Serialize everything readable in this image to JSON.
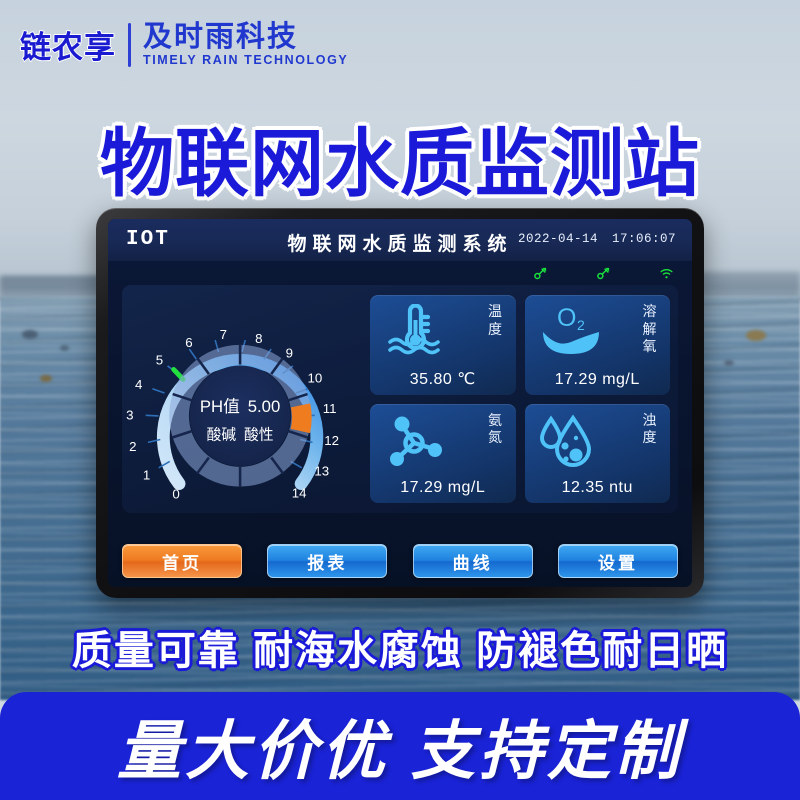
{
  "brand": {
    "mark": "链农享",
    "name_cn": "及时雨科技",
    "name_en": "TIMELY RAIN TECHNOLOGY"
  },
  "headline": "物联网水质监测站",
  "feature_line": "质量可靠 耐海水腐蚀 防褪色耐日晒",
  "banner": "量大价优 支持定制",
  "device": {
    "header": {
      "logo": "IOT",
      "title": "物联网水质监测系统",
      "date": "2022-04-14",
      "time": "17:06:07"
    },
    "status_icons": [
      {
        "name": "plug-icon",
        "color": "#19e03c"
      },
      {
        "name": "plug-icon",
        "color": "#19e03c"
      },
      {
        "name": "wifi-icon",
        "color": "#19e03c"
      }
    ],
    "gauge": {
      "label": "PH值",
      "value": "5.00",
      "sub_label": "酸碱",
      "sub_value": "酸性",
      "min": 0,
      "max": 14,
      "ticks": [
        "0",
        "1",
        "2",
        "3",
        "4",
        "5",
        "6",
        "7",
        "8",
        "9",
        "10",
        "11",
        "12",
        "13",
        "14"
      ],
      "marker_value": 5,
      "marker_color": "#22e03f",
      "alarm_value": 12,
      "alarm_color": "#ef7c1f"
    },
    "cards": [
      {
        "icon": "thermometer-water-icon",
        "label": "温度",
        "value": "35.80 ℃",
        "color": "#4fc2f7"
      },
      {
        "icon": "o2-water-icon",
        "label": "溶解氧",
        "value": "17.29 mg/L",
        "color": "#4fc2f7"
      },
      {
        "icon": "molecule-icon",
        "label": "氨氮",
        "value": "17.29 mg/L",
        "color": "#4fc2f7"
      },
      {
        "icon": "turbidity-droplet-icon",
        "label": "浊度",
        "value": "12.35 ntu",
        "color": "#4fc2f7"
      }
    ],
    "buttons": [
      {
        "label": "首页",
        "style": "orange"
      },
      {
        "label": "报表",
        "style": "blue"
      },
      {
        "label": "曲线",
        "style": "blue"
      },
      {
        "label": "设置",
        "style": "blue"
      }
    ]
  },
  "chart_data": {
    "type": "gauge",
    "title": "PH值",
    "value": 5.0,
    "display": "5.00",
    "range": [
      0,
      14
    ],
    "tick_labels": [
      "0",
      "1",
      "2",
      "3",
      "4",
      "5",
      "6",
      "7",
      "8",
      "9",
      "10",
      "11",
      "12",
      "13",
      "14"
    ],
    "marker": {
      "value": 5,
      "color": "#22e03f"
    },
    "alarm_segment": {
      "value": 12,
      "color": "#ef7c1f"
    },
    "annotation": "酸碱 酸性",
    "readouts": [
      {
        "name": "温度",
        "value": 35.8,
        "unit": "℃"
      },
      {
        "name": "溶解氧",
        "value": 17.29,
        "unit": "mg/L"
      },
      {
        "name": "氨氮",
        "value": 17.29,
        "unit": "mg/L"
      },
      {
        "name": "浊度",
        "value": 12.35,
        "unit": "ntu"
      }
    ]
  }
}
